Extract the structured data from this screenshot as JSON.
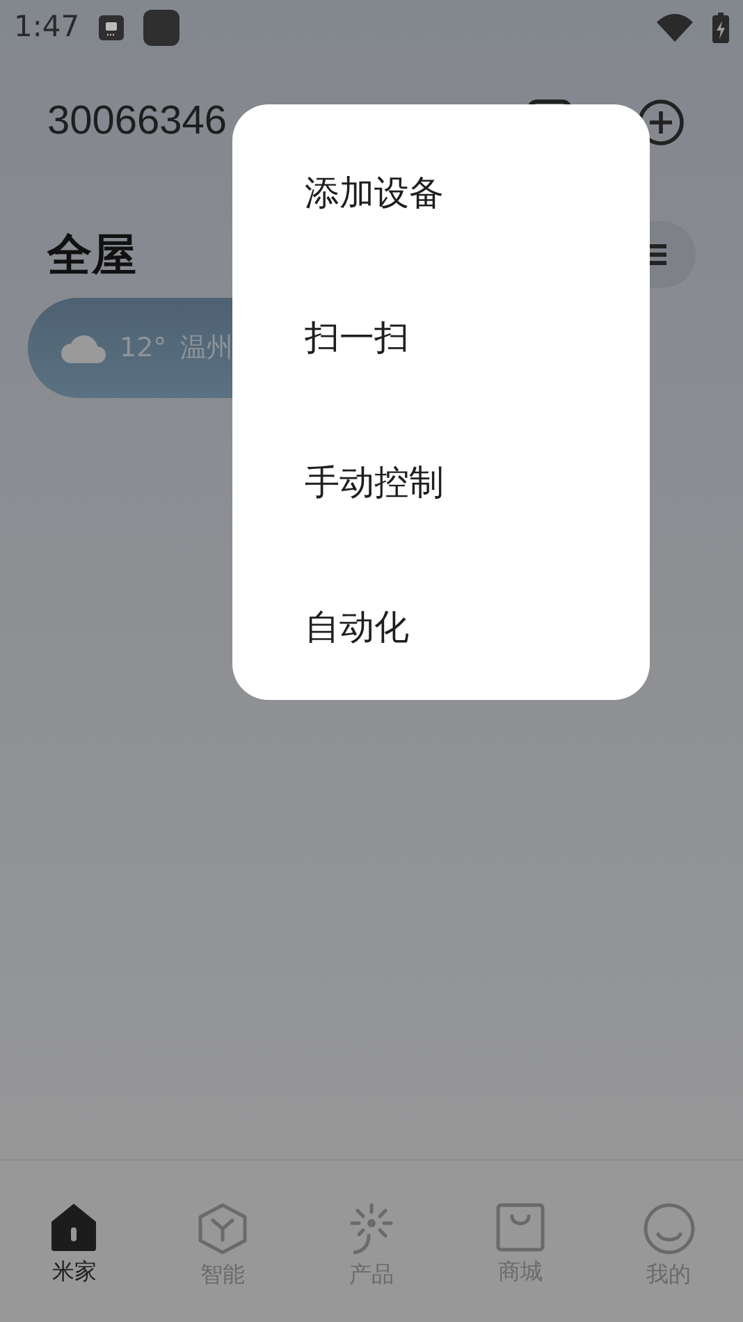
{
  "status_bar": {
    "time": "1:47"
  },
  "header": {
    "title": "30066346"
  },
  "section": {
    "title": "全屋"
  },
  "weather": {
    "temperature": "12°",
    "city": "温州"
  },
  "menu": {
    "items": [
      {
        "label": "添加设备"
      },
      {
        "label": "扫一扫"
      },
      {
        "label": "手动控制"
      },
      {
        "label": "自动化"
      }
    ]
  },
  "bottom_nav": [
    {
      "label": "米家",
      "kind": "home",
      "selected": true
    },
    {
      "label": "智能",
      "kind": "smart",
      "selected": false
    },
    {
      "label": "产品",
      "kind": "product",
      "selected": false
    },
    {
      "label": "商城",
      "kind": "shop",
      "selected": false
    },
    {
      "label": "我的",
      "kind": "me",
      "selected": false
    }
  ]
}
